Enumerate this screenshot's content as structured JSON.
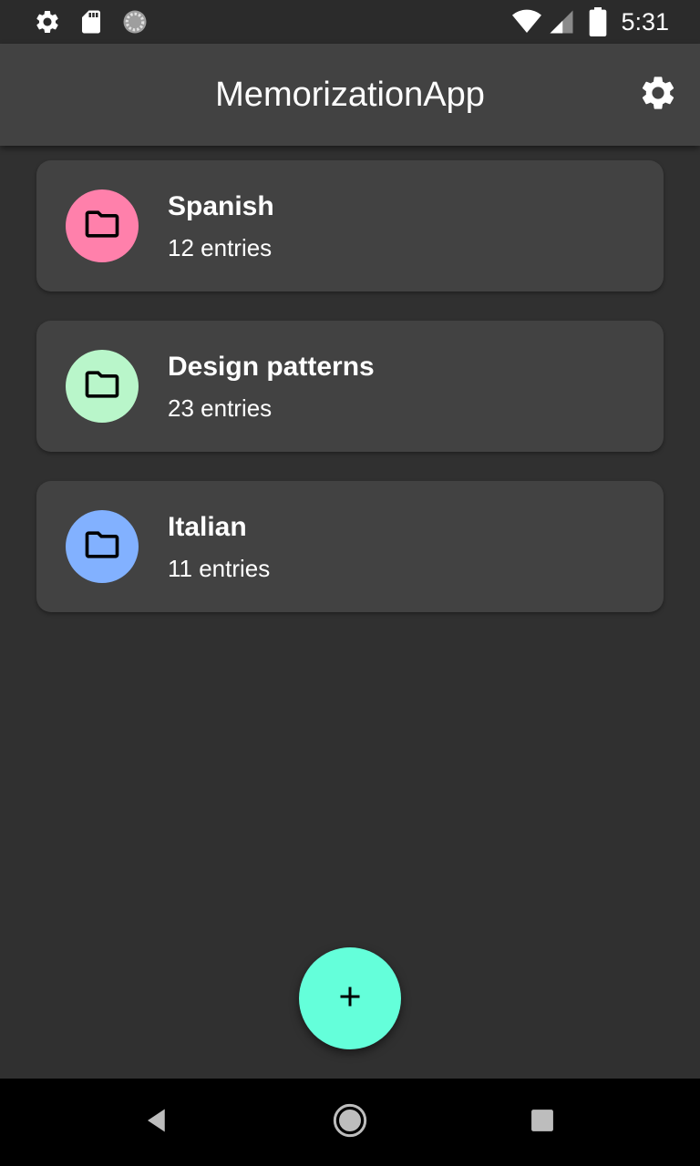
{
  "status_bar": {
    "time": "5:31",
    "left_icons": [
      "gear-icon",
      "sd-card-icon",
      "loading-icon"
    ],
    "right_icons": [
      "wifi-icon",
      "signal-icon",
      "battery-icon"
    ]
  },
  "app_bar": {
    "title": "MemorizationApp",
    "action_icon": "gear-icon"
  },
  "decks": [
    {
      "title": "Spanish",
      "subtitle": "12 entries",
      "color": "#ff80ab",
      "icon": "folder-icon"
    },
    {
      "title": "Design patterns",
      "subtitle": "23 entries",
      "color": "#b9f6ca",
      "icon": "folder-icon"
    },
    {
      "title": "Italian",
      "subtitle": "11 entries",
      "color": "#82b1ff",
      "icon": "folder-icon"
    }
  ],
  "fab": {
    "icon": "plus-icon",
    "color": "#64ffda"
  },
  "nav_bar": {
    "buttons": [
      "back-icon",
      "home-icon",
      "recents-icon"
    ]
  },
  "theme": {
    "background": "#303030",
    "surface": "#424242",
    "status_bar": "#2b2b2b",
    "nav_bar": "#000000"
  }
}
